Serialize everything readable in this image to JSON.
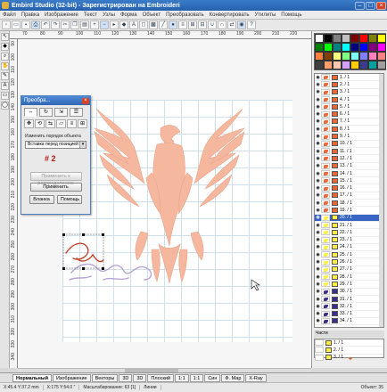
{
  "window": {
    "title": "Embird Studio (32-bit) - Зарегистрирован на Embroideri",
    "minimize": "–",
    "maximize": "□",
    "close": "×"
  },
  "menu": [
    "Файл",
    "Правка",
    "Изображение",
    "Текст",
    "Узлы",
    "Форма",
    "Объект",
    "Преобразовать",
    "Конвертировать",
    "Утилиты",
    "Помощь"
  ],
  "toolbar_icons": [
    "new-icon",
    "open-icon",
    "save-icon",
    "print-icon",
    "undo-icon",
    "redo-icon",
    "cut-icon",
    "copy-icon",
    "paste-icon",
    "zoom-in-icon",
    "zoom-out-icon",
    "select-icon",
    "node-icon",
    "text-icon",
    "shape-icon",
    "fill-icon",
    "stroke-icon",
    "color-icon",
    "align-icon",
    "group-icon",
    "ungroup-icon",
    "weld-icon",
    "trim-icon",
    "convert-icon",
    "preview-icon",
    "help-icon"
  ],
  "left_tools": [
    "arrow-icon",
    "node-icon",
    "zoom-icon",
    "pan-icon",
    "pen-icon",
    "text-icon",
    "rect-icon",
    "ellipse-icon"
  ],
  "ruler": {
    "top_ticks": [
      "70",
      "80",
      "90",
      "100",
      "110",
      "120",
      "130",
      "140",
      "150",
      "160",
      "170",
      "180",
      "190",
      "200",
      "210",
      "220"
    ],
    "left_ticks": [
      "90",
      "100",
      "110",
      "120",
      "130",
      "140",
      "150",
      "160",
      "170",
      "180",
      "190",
      "200",
      "210",
      "220",
      "230",
      "240",
      "250",
      "260",
      "270",
      "280",
      "290",
      "300",
      "310",
      "320",
      "330",
      "340"
    ]
  },
  "dialog": {
    "title": "Преобра...",
    "close": "×",
    "change_order_label": "Изменить порядок объекта",
    "order_option": "Вставка перед позицией",
    "position_number": "# 2",
    "apply_to_distribution": "Применить к распределению",
    "apply": "Применить",
    "cancel": "Bланка",
    "help": "Помощь"
  },
  "palette": [
    "#ffffff",
    "#000000",
    "#808080",
    "#c0c0c0",
    "#800000",
    "#ff0000",
    "#808000",
    "#ffff00",
    "#008000",
    "#00ff00",
    "#008080",
    "#00ffff",
    "#000080",
    "#0000ff",
    "#800080",
    "#ff00ff",
    "#ff8040",
    "#804000",
    "#ffff80",
    "#80ff80",
    "#80ffff",
    "#8080ff",
    "#ff80c0",
    "#ff8080",
    "#404040",
    "#ff9e6e",
    "#f9c8b0",
    "#d4a0ff",
    "#ffcc00",
    "#3c3c8c",
    "#00a0a0",
    "#a0a0a0"
  ],
  "objects": [
    {
      "label": "1. / 1",
      "color": "#ee6633"
    },
    {
      "label": "2. / 1",
      "color": "#ee6633"
    },
    {
      "label": "3. / 1",
      "color": "#ee6633"
    },
    {
      "label": "4. / 1",
      "color": "#ee6633"
    },
    {
      "label": "5. / 1",
      "color": "#ee6633"
    },
    {
      "label": "6. / 1",
      "color": "#ee6633"
    },
    {
      "label": "7. / 1",
      "color": "#ee6633"
    },
    {
      "label": "8. / 1",
      "color": "#ee6633"
    },
    {
      "label": "9. / 1",
      "color": "#ee6633"
    },
    {
      "label": "10. / 1",
      "color": "#ee6633"
    },
    {
      "label": "11. / 1",
      "color": "#ee6633"
    },
    {
      "label": "12. / 1",
      "color": "#ee6633"
    },
    {
      "label": "13. / 1",
      "color": "#ee6633"
    },
    {
      "label": "14. / 1",
      "color": "#ee6633"
    },
    {
      "label": "15. / 1",
      "color": "#ee6633"
    },
    {
      "label": "16. / 1",
      "color": "#ee6633"
    },
    {
      "label": "17. / 1",
      "color": "#ee6633"
    },
    {
      "label": "18. / 1",
      "color": "#ee6633"
    },
    {
      "label": "19. / 1",
      "color": "#ee6633"
    },
    {
      "label": "20. / 1",
      "color": "#ffee44",
      "selected": true
    },
    {
      "label": "21. / 1",
      "color": "#ffee44"
    },
    {
      "label": "22. / 1",
      "color": "#ffee44"
    },
    {
      "label": "23. / 1",
      "color": "#ffee44"
    },
    {
      "label": "24. / 1",
      "color": "#ffee44"
    },
    {
      "label": "25. / 1",
      "color": "#ffee44"
    },
    {
      "label": "26. / 1",
      "color": "#ffee44"
    },
    {
      "label": "27. / 1",
      "color": "#ffee44"
    },
    {
      "label": "28. / 1",
      "color": "#ffee44"
    },
    {
      "label": "29. / 1",
      "color": "#ffee44"
    },
    {
      "label": "30. / 1",
      "color": "#3a2f8a"
    },
    {
      "label": "31. / 1",
      "color": "#3a2f8a"
    },
    {
      "label": "32. / 1",
      "color": "#3a2f8a"
    },
    {
      "label": "33. / 1",
      "color": "#3a2f8a"
    },
    {
      "label": "34. / 1",
      "color": "#3a2f8a"
    }
  ],
  "parts": {
    "header": "Части",
    "items": [
      "1. / 1",
      "2. / 1",
      "3. / 1"
    ]
  },
  "canvas_text": "Сувенир",
  "view_tabs": [
    "Нормальный",
    "Изображение",
    "Векторы",
    "3D",
    "3D",
    "Плоский",
    "1:1",
    "1:1",
    "Син",
    "Ф. Мар",
    "X-Ray"
  ],
  "status": {
    "coords": "X:45.4 Y:37.2 mm",
    "size": "X:175 Y:54.0 \"",
    "zoom": "Масштабирование: 63 [1]",
    "mode": "Линии",
    "objects": "Объект: 35"
  },
  "colors": {
    "eagle_fill": "#f5b89f",
    "script_red": "#c0432a",
    "script_blue": "#b7a4d8",
    "accent_blue": "#2f67b3",
    "selected_row": "#3965c4"
  }
}
